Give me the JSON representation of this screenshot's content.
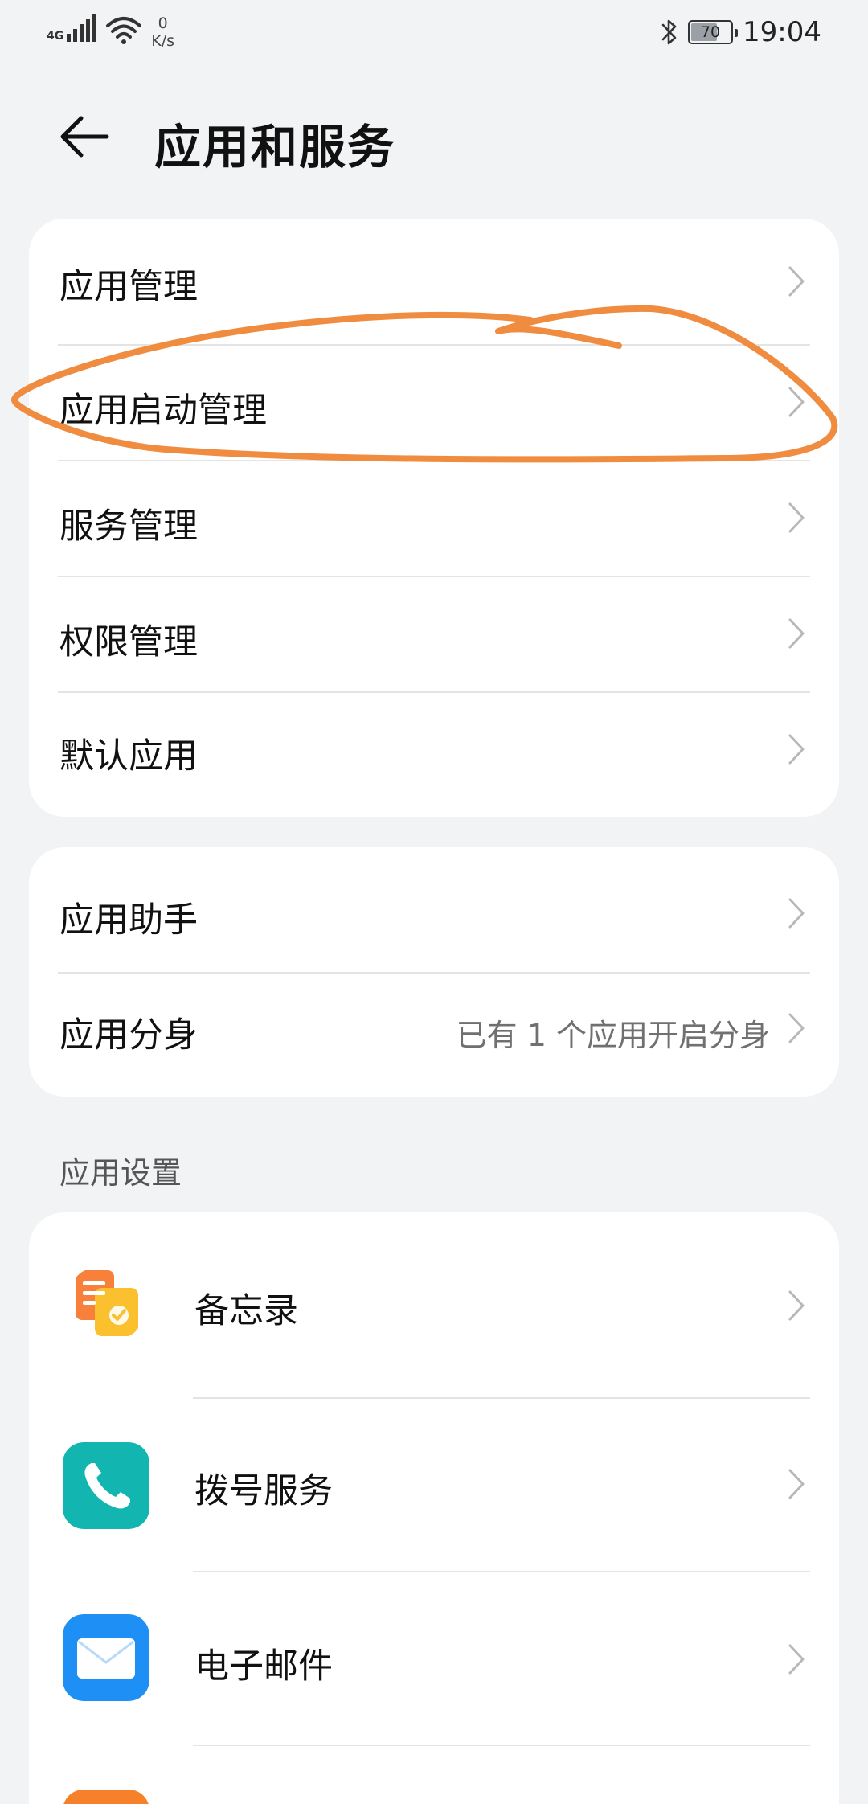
{
  "status_bar": {
    "network": "4G",
    "speed_value": "0",
    "speed_unit": "K/s",
    "battery": "70",
    "battery_level": 0.7,
    "time": "19:04"
  },
  "header": {
    "title": "应用和服务",
    "back_icon": "arrow-left-icon"
  },
  "group1": [
    {
      "label": "应用管理"
    },
    {
      "label": "应用启动管理"
    },
    {
      "label": "服务管理"
    },
    {
      "label": "权限管理"
    },
    {
      "label": "默认应用"
    }
  ],
  "group2": [
    {
      "label": "应用助手",
      "value": ""
    },
    {
      "label": "应用分身",
      "value": "已有 1 个应用开启分身"
    }
  ],
  "app_settings": {
    "section_title": "应用设置",
    "apps": [
      {
        "label": "备忘录",
        "icon": "memo-icon"
      },
      {
        "label": "拨号服务",
        "icon": "phone-icon",
        "color": "#13b5b1"
      },
      {
        "label": "电子邮件",
        "icon": "mail-icon",
        "color": "#1e8ff5"
      },
      {
        "label": "",
        "icon": "app-icon-orange",
        "color": "#f7812a"
      }
    ]
  },
  "annotation_color": "#f08c40"
}
